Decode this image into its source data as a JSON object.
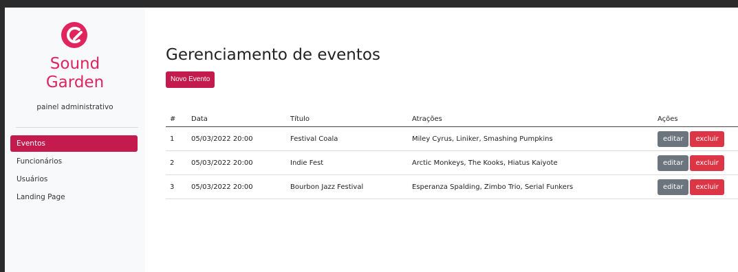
{
  "brand": {
    "line1": "Sound",
    "line2": "Garden",
    "subtitle": "painel administrativo",
    "icon": "soundgarden-logo-icon",
    "color": "#e0245e"
  },
  "nav": {
    "items": [
      {
        "label": "Eventos",
        "active": true
      },
      {
        "label": "Funcionários",
        "active": false
      },
      {
        "label": "Usuários",
        "active": false
      },
      {
        "label": "Landing Page",
        "active": false
      }
    ],
    "active_color": "#c41b4e"
  },
  "main": {
    "title": "Gerenciamento de eventos",
    "new_button": "Novo Evento"
  },
  "table": {
    "headers": [
      "#",
      "Data",
      "Título",
      "Atrações",
      "Ações"
    ],
    "rows": [
      {
        "num": "1",
        "date": "05/03/2022 20:00",
        "title": "Festival Coala",
        "attractions": "Miley Cyrus, Liniker, Smashing Pumpkins"
      },
      {
        "num": "2",
        "date": "05/03/2022 20:00",
        "title": "Indie Fest",
        "attractions": "Arctic Monkeys, The Kooks, Hiatus Kaiyote"
      },
      {
        "num": "3",
        "date": "05/03/2022 20:00",
        "title": "Bourbon Jazz Festival",
        "attractions": "Esperanza Spalding, Zimbo Trio, Serial Funkers"
      }
    ],
    "edit_label": "editar",
    "delete_label": "excluir"
  }
}
